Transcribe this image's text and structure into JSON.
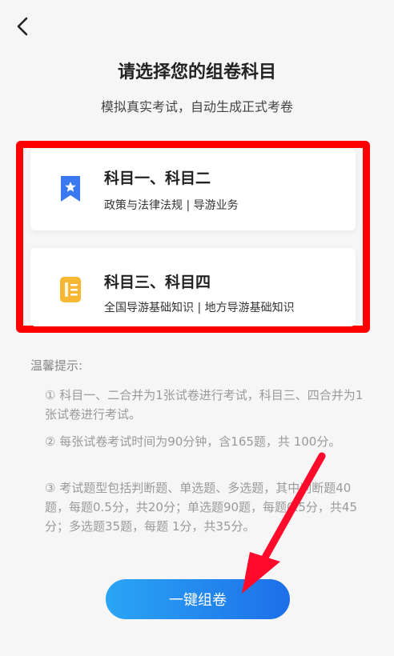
{
  "header": {
    "back_icon": "chevron-left-icon",
    "title": "请选择您的组卷科目",
    "subtitle": "模拟真实考试，自动生成正式考卷"
  },
  "subjects": [
    {
      "title": "科目一、科目二",
      "desc": "政策与法律法规 | 导游业务",
      "icon": "bookmark-star-icon",
      "icon_color": "#3a78f0"
    },
    {
      "title": "科目三、科目四",
      "desc": "全国导游基础知识 | 地方导游基础知识",
      "icon": "document-icon",
      "icon_color": "#f7b733"
    }
  ],
  "tips": {
    "title": "温馨提示:",
    "items": [
      "① 科目一、二合并为1张试卷进行考试，科目三、四合并为1张试卷进行考试。",
      "② 每张试卷考试时间为90分钟，含165题，共 100分。",
      "③ 考试题型包括判断题、单选题、多选题，其中判断题40题，每题0.5分，共20分；单选题90题，每题0.5分，共45分；多选题35题，每题 1分，共35分。"
    ]
  },
  "action": {
    "label": "一键组卷"
  },
  "annotation": {
    "highlight_color": "#ff0000",
    "arrow_color": "#ff0a2a"
  },
  "colors": {
    "accent_start": "#2aa5f5",
    "accent_end": "#1d6fe8"
  }
}
